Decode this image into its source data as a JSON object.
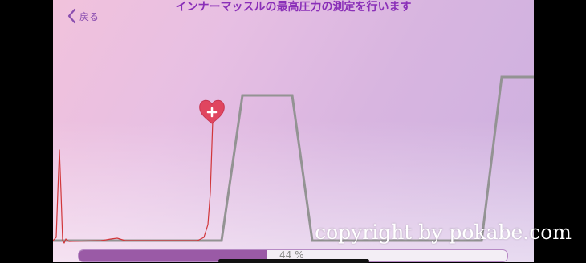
{
  "header": {
    "back_label": "戻る",
    "title": "インナーマッスルの最高圧力の測定を行います"
  },
  "progress": {
    "label": "44 %",
    "value": 0.44
  },
  "watermark": "copyright by pokabe.com",
  "colors": {
    "title": "#8a2fb8",
    "target_line": "#939393",
    "pressure_line": "#d1363a",
    "heart": "#e0455f",
    "progress_fill": "#9a5aa6"
  }
}
